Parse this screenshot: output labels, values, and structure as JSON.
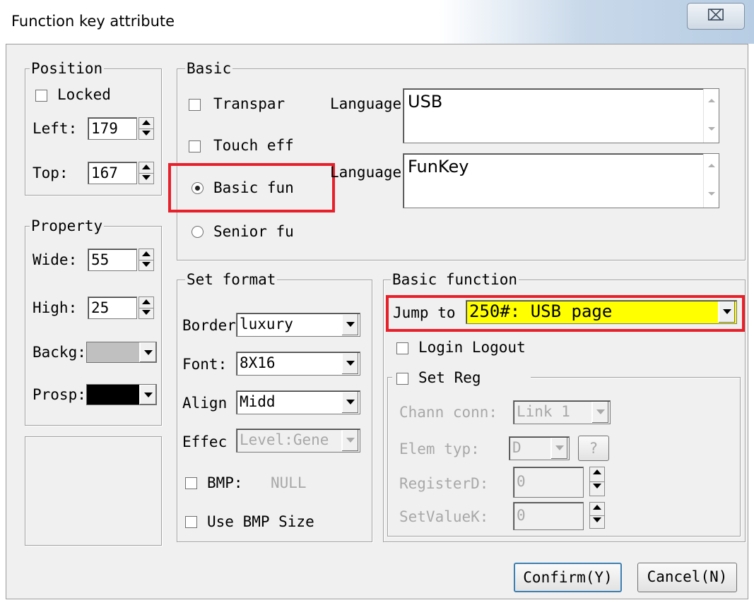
{
  "window": {
    "title": "Function key attribute",
    "close_glyph": "⌧"
  },
  "position": {
    "label": "Position",
    "locked_label": "Locked",
    "left_label": "Left:",
    "left_value": "179",
    "top_label": "Top:",
    "top_value": "167"
  },
  "property": {
    "label": "Property",
    "wide_label": "Wide:",
    "wide_value": "55",
    "high_label": "High:",
    "high_value": "25",
    "backg_label": "Backg:",
    "backg_color": "#c0c0c0",
    "prosp_label": "Prosp:",
    "prosp_color": "#000000"
  },
  "basic": {
    "label": "Basic",
    "transparent_label": "Transpar",
    "touch_label": "Touch eff",
    "basic_fun_label": "Basic fun",
    "senior_fu_label": "Senior fu",
    "language1_label": "Language",
    "language1_text": "USB",
    "language2_label": "Language",
    "language2_text": "FunKey"
  },
  "set_format": {
    "label": "Set format",
    "border_label": "Border",
    "border_value": "luxury",
    "font_label": "Font:",
    "font_value": "8X16",
    "align_label": "Align",
    "align_value": "Midd",
    "effect_label": "Effec",
    "effect_value": "Level:Gene",
    "bmp_label": "BMP:",
    "bmp_value": "NULL",
    "use_bmp_size_label": "Use BMP Size"
  },
  "basic_function": {
    "label": "Basic function",
    "jump_label": "Jump to",
    "jump_value": "250#: USB page",
    "login_logout_label": "Login Logout",
    "set_reg_label": "Set Reg",
    "chann_label": "Chann conn:",
    "chann_value": "Link 1",
    "elem_label": "Elem typ:",
    "elem_value": "D",
    "elem_help": "?",
    "register_label": "RegisterD:",
    "register_value": "0",
    "setvalue_label": "SetValueK:",
    "setvalue_value": "0"
  },
  "buttons": {
    "confirm": "Confirm(Y)",
    "cancel": "Cancel(N)"
  },
  "colors": {
    "highlight_box": "#e8202a",
    "jump_field_bg": "#ffff00"
  }
}
